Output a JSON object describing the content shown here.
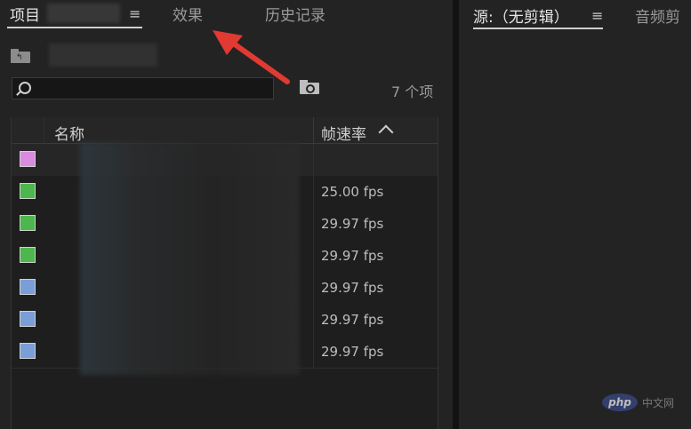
{
  "tabs": {
    "project": "项目",
    "effects": "效果",
    "history": "历史记录"
  },
  "right_tabs": {
    "source": "源:（无剪辑）",
    "audio": "音频剪"
  },
  "project": {
    "item_count": "7 个项",
    "columns": {
      "name": "名称",
      "frame_rate": "帧速率"
    },
    "rows": [
      {
        "color": "#d98be0",
        "fps": ""
      },
      {
        "color": "#4fb54f",
        "fps": "25.00 fps"
      },
      {
        "color": "#4fb54f",
        "fps": "29.97 fps"
      },
      {
        "color": "#4fb54f",
        "fps": "29.97 fps"
      },
      {
        "color": "#7a9fd6",
        "fps": "29.97 fps"
      },
      {
        "color": "#7a9fd6",
        "fps": "29.97 fps"
      },
      {
        "color": "#7a9fd6",
        "fps": "29.97 fps"
      }
    ]
  },
  "watermark": {
    "logo": "php",
    "text": "中文网"
  },
  "icons": [
    "menu-icon",
    "folder-up-icon",
    "search-icon",
    "bin-search-icon",
    "sort-ascending-icon",
    "arrow-annotation-icon"
  ]
}
